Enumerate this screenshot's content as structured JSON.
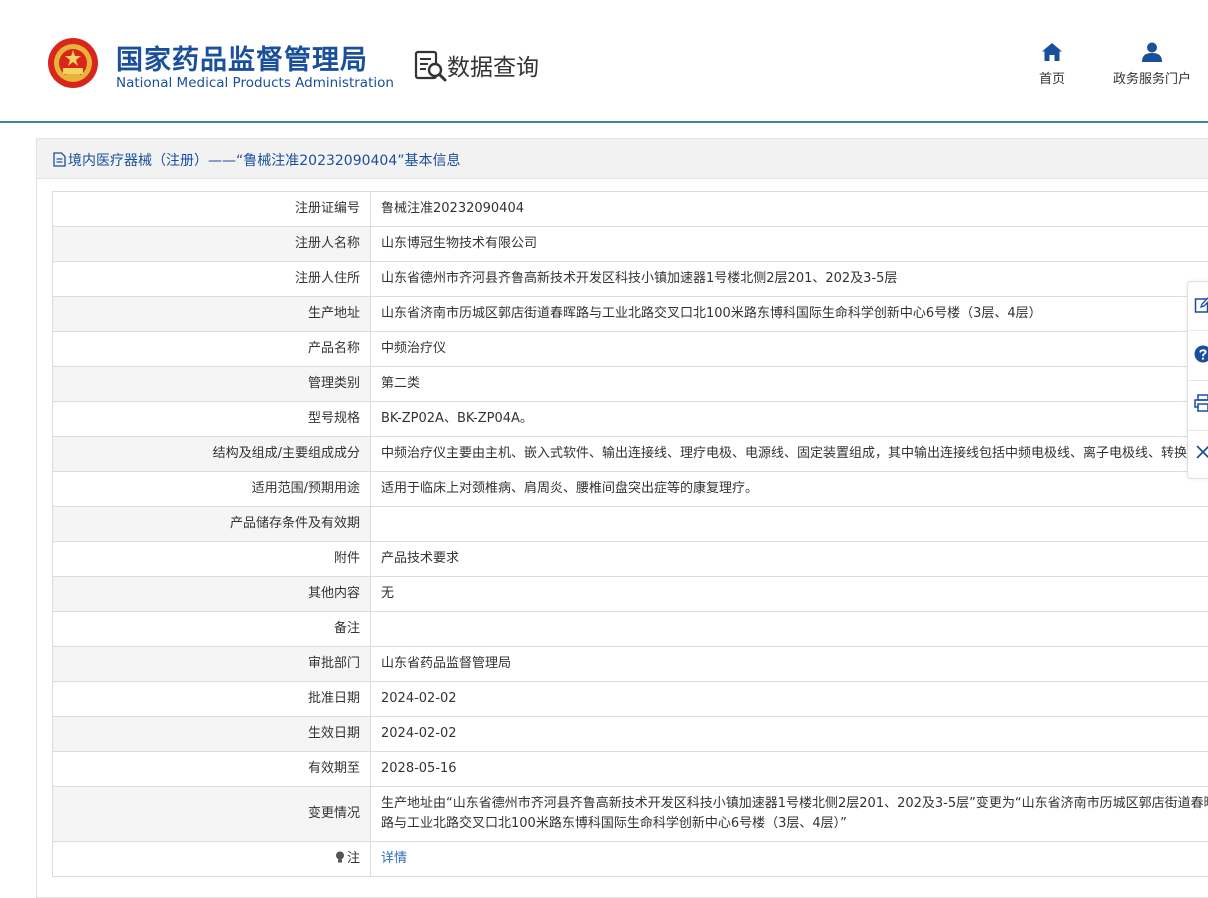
{
  "header": {
    "site_title_cn": "国家药品监督管理局",
    "site_title_en": "National Medical Products Administration",
    "section_title": "数据查询",
    "nav": [
      {
        "label": "首页",
        "icon": "home-icon"
      },
      {
        "label": "政务服务门户",
        "icon": "user-icon"
      }
    ]
  },
  "panel": {
    "title": "境内医疗器械（注册）——“鲁械注准20232090404”基本信息"
  },
  "rows": [
    {
      "label": "注册证编号",
      "value": "鲁械注准20232090404"
    },
    {
      "label": "注册人名称",
      "value": "山东博冠生物技术有限公司"
    },
    {
      "label": "注册人住所",
      "value": "山东省德州市齐河县齐鲁高新技术开发区科技小镇加速器1号楼北侧2层201、202及3-5层"
    },
    {
      "label": "生产地址",
      "value": "山东省济南市历城区郭店街道春晖路与工业北路交叉口北100米路东博科国际生命科学创新中心6号楼（3层、4层）"
    },
    {
      "label": "产品名称",
      "value": "中频治疗仪"
    },
    {
      "label": "管理类别",
      "value": "第二类"
    },
    {
      "label": "型号规格",
      "value": "BK-ZP02A、BK-ZP04A。"
    },
    {
      "label": "结构及组成/主要组成成分",
      "value": "中频治疗仪主要由主机、嵌入式软件、输出连接线、理疗电极、电源线、固定装置组成，其中输出连接线包括中频电极线、离子电极线、转换线。"
    },
    {
      "label": "适用范围/预期用途",
      "value": "适用于临床上对颈椎病、肩周炎、腰椎间盘突出症等的康复理疗。"
    },
    {
      "label": "产品储存条件及有效期",
      "value": ""
    },
    {
      "label": "附件",
      "value": "产品技术要求"
    },
    {
      "label": "其他内容",
      "value": "无"
    },
    {
      "label": "备注",
      "value": ""
    },
    {
      "label": "审批部门",
      "value": "山东省药品监督管理局"
    },
    {
      "label": "批准日期",
      "value": "2024-02-02"
    },
    {
      "label": "生效日期",
      "value": "2024-02-02"
    },
    {
      "label": "有效期至",
      "value": "2028-05-16"
    },
    {
      "label": "变更情况",
      "value": "生产地址由“山东省德州市齐河县齐鲁高新技术开发区科技小镇加速器1号楼北侧2层201、202及3-5层”变更为“山东省济南市历城区郭店街道春晖路与工业北路交叉口北100米路东博科国际生命科学创新中心6号楼（3层、4层）”"
    }
  ],
  "note_row": {
    "label": "注",
    "link": "详情"
  },
  "side_tools": [
    "edit-icon",
    "help-icon",
    "print-icon",
    "close-icon"
  ],
  "colors": {
    "brand": "#1a4f9c",
    "accent_line": "#3d8a96",
    "link": "#2a6ebf"
  }
}
